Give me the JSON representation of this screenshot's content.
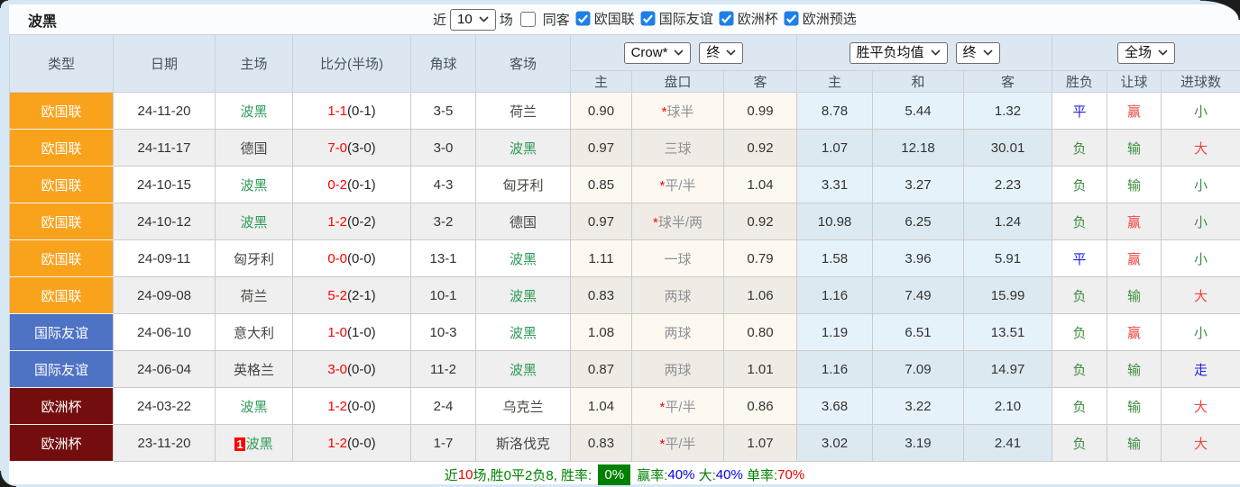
{
  "header": {
    "title": "波黑",
    "recent_label": "近",
    "recent_count": "10",
    "matches_label": "场",
    "same_venue": {
      "label": "同客",
      "checked": false
    },
    "league_filters": [
      {
        "label": "欧国联",
        "checked": true
      },
      {
        "label": "国际友谊",
        "checked": true
      },
      {
        "label": "欧洲杯",
        "checked": true
      },
      {
        "label": "欧洲预选",
        "checked": true
      }
    ]
  },
  "table": {
    "columns": [
      "类型",
      "日期",
      "主场",
      "比分(半场)",
      "角球",
      "客场"
    ],
    "group_selects": {
      "odds_source": "Crow*",
      "odds_time": "终",
      "avg_source": "胜平负均值",
      "avg_time": "终",
      "scope": "全场"
    },
    "sub_columns": [
      "主",
      "盘口",
      "客",
      "主",
      "和",
      "客",
      "胜负",
      "让球",
      "进球数"
    ],
    "rows": [
      {
        "type": "欧国联",
        "type_color": "orange",
        "date": "24-11-20",
        "home": "波黑",
        "home_hl": true,
        "home_badge": "",
        "score": "1-1",
        "half": "(0-1)",
        "corners": "3-5",
        "away": "荷兰",
        "away_hl": false,
        "odds_home": "0.90",
        "handicap_star": true,
        "handicap": "球半",
        "odds_away": "0.99",
        "avg_home": "8.78",
        "avg_draw": "5.44",
        "avg_away": "1.32",
        "result": "平",
        "result_color": "blue",
        "rq": "赢",
        "rq_color": "red",
        "goals": "小",
        "goals_color": "green"
      },
      {
        "type": "欧国联",
        "type_color": "orange",
        "date": "24-11-17",
        "home": "德国",
        "home_hl": false,
        "home_badge": "",
        "score": "7-0",
        "half": "(3-0)",
        "corners": "3-0",
        "away": "波黑",
        "away_hl": true,
        "odds_home": "0.97",
        "handicap_star": false,
        "handicap": "三球",
        "odds_away": "0.92",
        "avg_home": "1.07",
        "avg_draw": "12.18",
        "avg_away": "30.01",
        "result": "负",
        "result_color": "green",
        "rq": "输",
        "rq_color": "green",
        "goals": "大",
        "goals_color": "red"
      },
      {
        "type": "欧国联",
        "type_color": "orange",
        "date": "24-10-15",
        "home": "波黑",
        "home_hl": true,
        "home_badge": "",
        "score": "0-2",
        "half": "(0-1)",
        "corners": "4-3",
        "away": "匈牙利",
        "away_hl": false,
        "odds_home": "0.85",
        "handicap_star": true,
        "handicap": "平/半",
        "odds_away": "1.04",
        "avg_home": "3.31",
        "avg_draw": "3.27",
        "avg_away": "2.23",
        "result": "负",
        "result_color": "green",
        "rq": "输",
        "rq_color": "green",
        "goals": "小",
        "goals_color": "green"
      },
      {
        "type": "欧国联",
        "type_color": "orange",
        "date": "24-10-12",
        "home": "波黑",
        "home_hl": true,
        "home_badge": "",
        "score": "1-2",
        "half": "(0-2)",
        "corners": "3-2",
        "away": "德国",
        "away_hl": false,
        "odds_home": "0.97",
        "handicap_star": true,
        "handicap": "球半/两",
        "odds_away": "0.92",
        "avg_home": "10.98",
        "avg_draw": "6.25",
        "avg_away": "1.24",
        "result": "负",
        "result_color": "green",
        "rq": "赢",
        "rq_color": "red",
        "goals": "小",
        "goals_color": "green"
      },
      {
        "type": "欧国联",
        "type_color": "orange",
        "date": "24-09-11",
        "home": "匈牙利",
        "home_hl": false,
        "home_badge": "",
        "score": "0-0",
        "half": "(0-0)",
        "corners": "13-1",
        "away": "波黑",
        "away_hl": true,
        "odds_home": "1.11",
        "handicap_star": false,
        "handicap": "一球",
        "odds_away": "0.79",
        "avg_home": "1.58",
        "avg_draw": "3.96",
        "avg_away": "5.91",
        "result": "平",
        "result_color": "blue",
        "rq": "赢",
        "rq_color": "red",
        "goals": "小",
        "goals_color": "green"
      },
      {
        "type": "欧国联",
        "type_color": "orange",
        "date": "24-09-08",
        "home": "荷兰",
        "home_hl": false,
        "home_badge": "",
        "score": "5-2",
        "half": "(2-1)",
        "corners": "10-1",
        "away": "波黑",
        "away_hl": true,
        "odds_home": "0.83",
        "handicap_star": false,
        "handicap": "两球",
        "odds_away": "1.06",
        "avg_home": "1.16",
        "avg_draw": "7.49",
        "avg_away": "15.99",
        "result": "负",
        "result_color": "green",
        "rq": "输",
        "rq_color": "green",
        "goals": "大",
        "goals_color": "red"
      },
      {
        "type": "国际友谊",
        "type_color": "blue",
        "date": "24-06-10",
        "home": "意大利",
        "home_hl": false,
        "home_badge": "",
        "score": "1-0",
        "half": "(1-0)",
        "corners": "10-3",
        "away": "波黑",
        "away_hl": true,
        "odds_home": "1.08",
        "handicap_star": false,
        "handicap": "两球",
        "odds_away": "0.80",
        "avg_home": "1.19",
        "avg_draw": "6.51",
        "avg_away": "13.51",
        "result": "负",
        "result_color": "green",
        "rq": "赢",
        "rq_color": "red",
        "goals": "小",
        "goals_color": "green"
      },
      {
        "type": "国际友谊",
        "type_color": "blue",
        "date": "24-06-04",
        "home": "英格兰",
        "home_hl": false,
        "home_badge": "",
        "score": "3-0",
        "half": "(0-0)",
        "corners": "11-2",
        "away": "波黑",
        "away_hl": true,
        "odds_home": "0.87",
        "handicap_star": false,
        "handicap": "两球",
        "odds_away": "1.01",
        "avg_home": "1.16",
        "avg_draw": "7.09",
        "avg_away": "14.97",
        "result": "负",
        "result_color": "green",
        "rq": "输",
        "rq_color": "green",
        "goals": "走",
        "goals_color": "blue"
      },
      {
        "type": "欧洲杯",
        "type_color": "maroon",
        "date": "24-03-22",
        "home": "波黑",
        "home_hl": true,
        "home_badge": "",
        "score": "1-2",
        "half": "(0-0)",
        "corners": "2-4",
        "away": "乌克兰",
        "away_hl": false,
        "odds_home": "1.04",
        "handicap_star": true,
        "handicap": "平/半",
        "odds_away": "0.86",
        "avg_home": "3.68",
        "avg_draw": "3.22",
        "avg_away": "2.10",
        "result": "负",
        "result_color": "green",
        "rq": "输",
        "rq_color": "green",
        "goals": "大",
        "goals_color": "red"
      },
      {
        "type": "欧洲杯",
        "type_color": "maroon",
        "date": "23-11-20",
        "home": "波黑",
        "home_hl": true,
        "home_badge": "1",
        "score": "1-2",
        "half": "(0-0)",
        "corners": "1-7",
        "away": "斯洛伐克",
        "away_hl": false,
        "odds_home": "0.83",
        "handicap_star": true,
        "handicap": "平/半",
        "odds_away": "1.07",
        "avg_home": "3.02",
        "avg_draw": "3.19",
        "avg_away": "2.41",
        "result": "负",
        "result_color": "green",
        "rq": "输",
        "rq_color": "green",
        "goals": "大",
        "goals_color": "red"
      }
    ]
  },
  "footer": {
    "segments": [
      {
        "text": "近",
        "color": "green"
      },
      {
        "text": "10",
        "color": "red"
      },
      {
        "text": "场,胜0平2负8, 胜率: ",
        "color": "green"
      },
      {
        "text": "0%",
        "color": "badge"
      },
      {
        "text": " 赢率:",
        "color": "green"
      },
      {
        "text": "40%",
        "color": "blue"
      },
      {
        "text": " 大:",
        "color": "green"
      },
      {
        "text": "40%",
        "color": "blue"
      },
      {
        "text": " 单率:",
        "color": "green"
      },
      {
        "text": "70%",
        "color": "red"
      }
    ]
  },
  "colors": {
    "page_margin": "#d8e7f4",
    "header_bg": "#dde7f1",
    "league_orange": "#f9a21c",
    "league_blue": "#4e72c4",
    "league_maroon": "#740e0e",
    "team_highlight_green": "#2e9b57",
    "score_red": "#fe0000",
    "crow_col_bg": "#fdf9f1",
    "avg_col_bg": "#e6f2f9",
    "row_alt_bg": "#efefef",
    "result_draw_blue": "#2222dd",
    "result_lose_green": "#3e8e41",
    "result_win_red": "#f04444",
    "footer_rate_badge_green": "#008000",
    "checkbox_blue": "#1f7fe8",
    "badge_red": "#fd0000"
  }
}
